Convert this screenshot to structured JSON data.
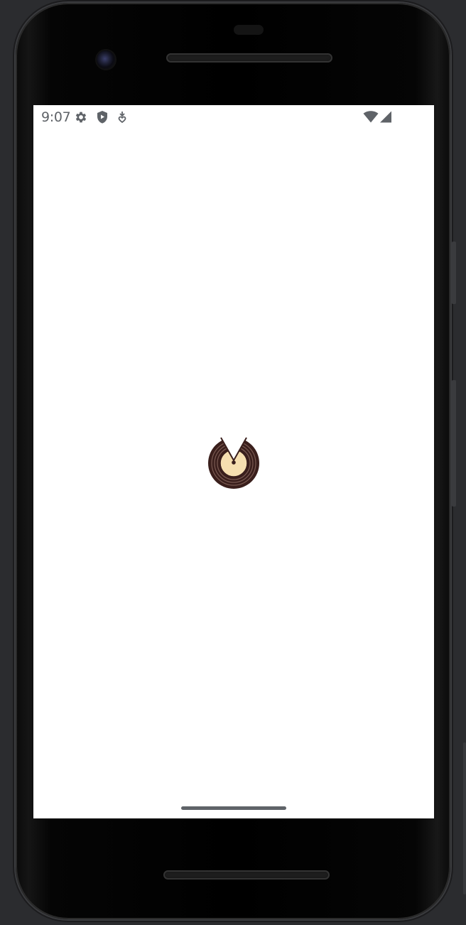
{
  "status_bar": {
    "time": "9:07",
    "icons": [
      "gear-icon",
      "shield-play-icon",
      "download-icon",
      "wifi-icon",
      "cell-signal-icon"
    ]
  },
  "splash": {
    "logo": "vinyl-record-logo-icon",
    "colors": {
      "record": "#3a1f1c",
      "label": "#f6dfb0"
    }
  },
  "device": {
    "frame": "android-phone",
    "bezel_color": "#000000",
    "background": "#2b2c2f"
  }
}
